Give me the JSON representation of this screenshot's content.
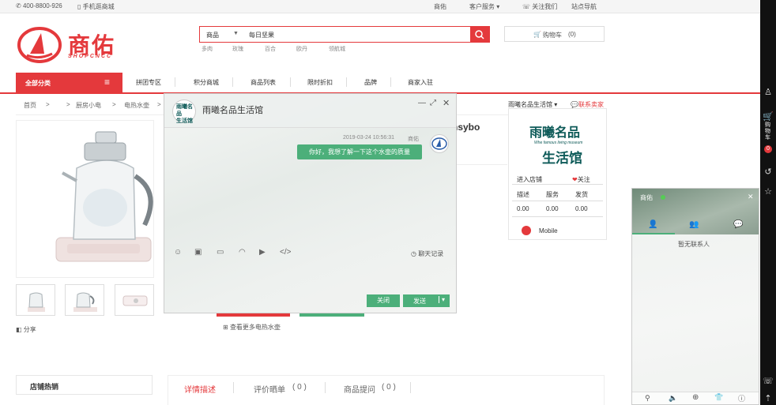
{
  "topbar": {
    "phone": "400-8800-926",
    "mobile_mall": "手机逛商城",
    "links": [
      "商佑",
      "客户服务",
      "关注我们",
      "站点导航"
    ]
  },
  "logo": {
    "cn": "商佑",
    "en": "SHOPCNCC"
  },
  "search": {
    "scope": "商品",
    "value": "每日坚果",
    "hotwords": [
      "多肉",
      "玫瑰",
      "百合",
      "欧丹",
      "领航城"
    ]
  },
  "cart": {
    "label": "购物车",
    "count": "(0)"
  },
  "nav": {
    "all_categories": "全部分类",
    "items": [
      "拼团专区",
      "积分商城",
      "商品列表",
      "限时折扣",
      "品牌",
      "商家入驻"
    ]
  },
  "breadcrumb": [
    "首页",
    ">",
    ">",
    "厨房小电",
    ">",
    "电热水壶",
    ">"
  ],
  "product": {
    "title_fragment": "nsybo",
    "share": "分享",
    "more_link": "查看更多电热水壶"
  },
  "store": {
    "header_name": "雨曦名品生活馆",
    "contact": "联系卖家",
    "logo_line1": "雨曦名品",
    "logo_sub": "Whe famous living museum",
    "logo_line2": "生活馆",
    "enter": "进入店铺",
    "follow": "关注",
    "score_labels": [
      "描述",
      "服务",
      "发货"
    ],
    "score_values": [
      "0.00",
      "0.00",
      "0.00"
    ],
    "mobile": "Mobile"
  },
  "lower": {
    "hot_sales": "店铺热销",
    "tabs": [
      "详情描述",
      "评价晒单",
      "( 0 )",
      "商品提问",
      "( 0 )"
    ]
  },
  "chat": {
    "title": "雨曦名品生活馆",
    "timestamp": "2019-03-24 10:56:31",
    "sender": "商佑",
    "message": "你好，我想了解一下这个水壶的质量",
    "history": "聊天记录",
    "close": "关闭",
    "send": "发送"
  },
  "chat_panel": {
    "user": "商佑",
    "empty": "暂无联系人"
  },
  "sidebar": {
    "cart_label": "购物车",
    "cart_count": "0"
  },
  "colors": {
    "brand_red": "#e4393c",
    "chat_green": "#4caf7a"
  }
}
